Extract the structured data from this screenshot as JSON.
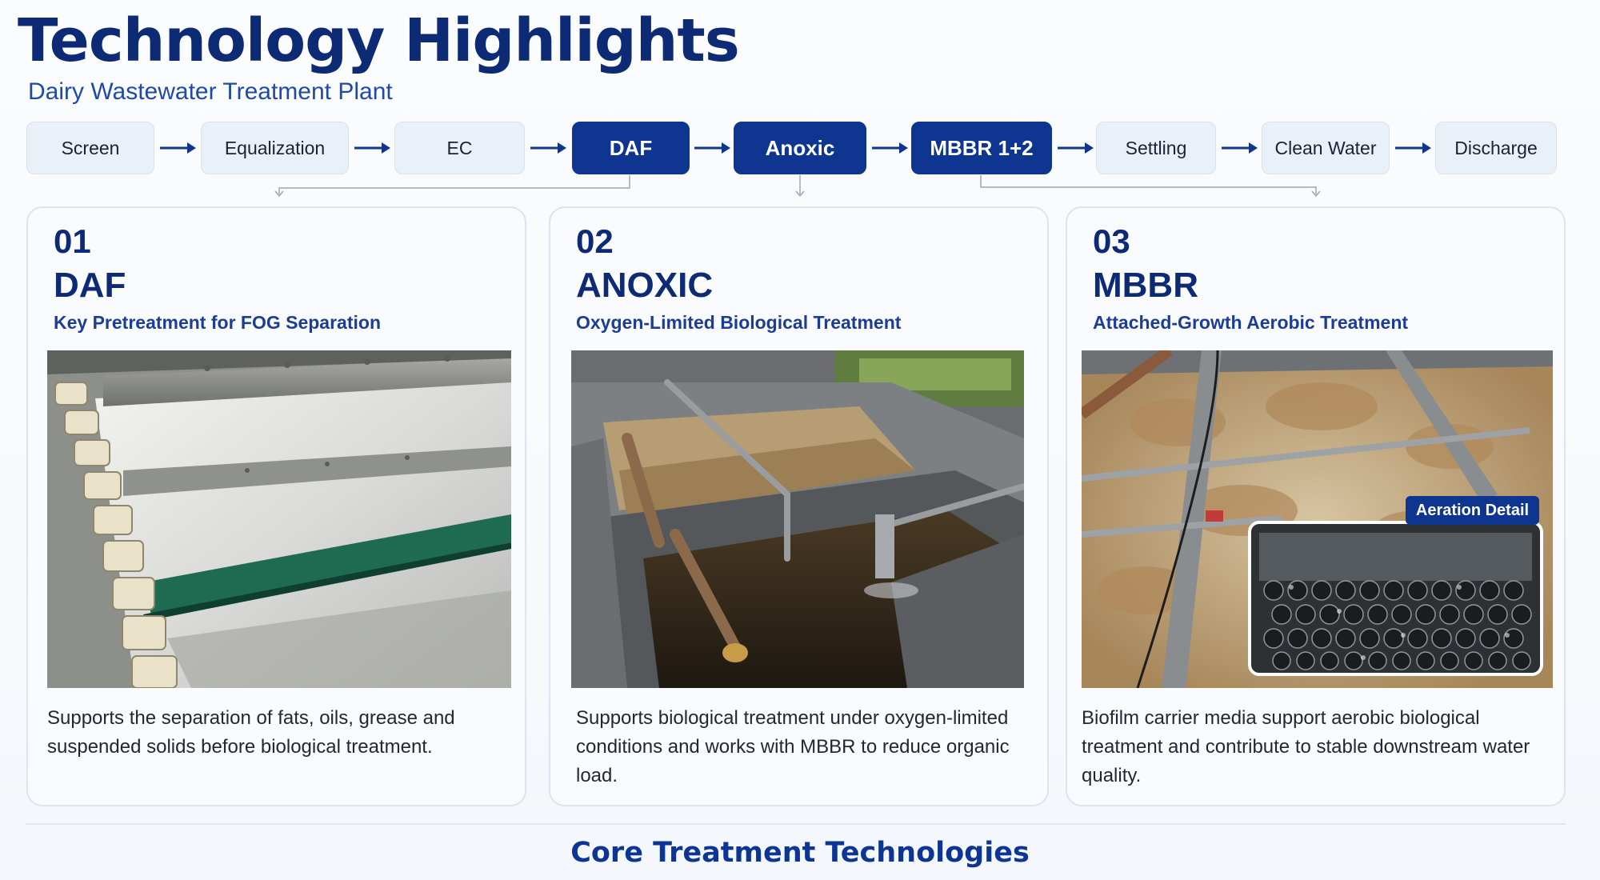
{
  "header": {
    "title": "Technology Highlights",
    "subtitle": "Dairy Wastewater Treatment Plant"
  },
  "flow": {
    "steps": [
      {
        "label": "Screen",
        "active": false
      },
      {
        "label": "Equalization",
        "active": false
      },
      {
        "label": "EC",
        "active": false
      },
      {
        "label": "DAF",
        "active": true
      },
      {
        "label": "Anoxic",
        "active": true
      },
      {
        "label": "MBBR 1+2",
        "active": true
      },
      {
        "label": "Settling",
        "active": false
      },
      {
        "label": "Clean Water",
        "active": false
      },
      {
        "label": "Discharge",
        "active": false
      }
    ]
  },
  "cards": [
    {
      "number": "01",
      "name": "DAF",
      "tagline": "Key Pretreatment for FOG Separation",
      "description": "Supports the separation of fats, oils, grease and suspended solids before biological treatment."
    },
    {
      "number": "02",
      "name": "ANOXIC",
      "tagline": "Oxygen-Limited Biological Treatment",
      "description": "Supports biological treatment under oxygen-limited conditions and works with MBBR to reduce organic load."
    },
    {
      "number": "03",
      "name": "MBBR",
      "tagline": "Attached-Growth Aerobic Treatment",
      "description": "Biofilm carrier media support aerobic biological treatment and contribute to stable downstream water quality.",
      "inset_label": "Aeration Detail"
    }
  ],
  "footer": {
    "label": "Core Treatment Technologies"
  },
  "colors": {
    "primary": "#0d2a74",
    "active_step": "#0e3590",
    "step_bg": "#eaf0f7",
    "accent_blue": "#1f4aa8"
  }
}
